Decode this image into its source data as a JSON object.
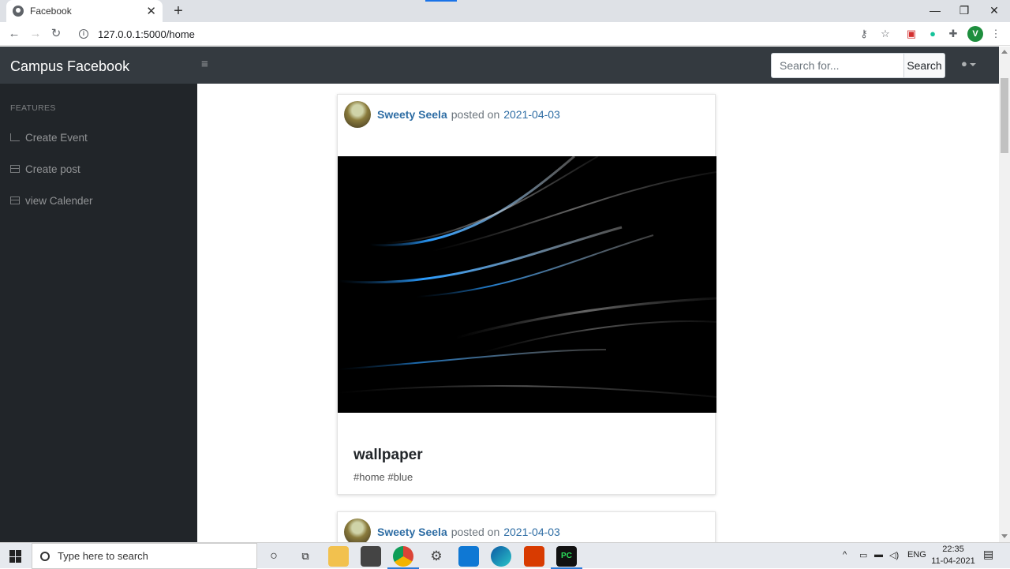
{
  "browser": {
    "tab_title": "Facebook",
    "url": "127.0.0.1:5000/home",
    "profile_initial": "V"
  },
  "navbar": {
    "brand": "Campus Facebook",
    "search_placeholder": "Search for...",
    "search_button": "Search"
  },
  "sidebar": {
    "heading": "FEATURES",
    "items": [
      {
        "label": "Create Event",
        "icon": "chart-area-icon"
      },
      {
        "label": "Create post",
        "icon": "table-icon"
      },
      {
        "label": "view Calender",
        "icon": "table-icon"
      }
    ]
  },
  "posts": [
    {
      "author": "Sweety Seela",
      "posted_on": "posted on",
      "date": "2021-04-03",
      "title": "wallpaper",
      "tags": "#home #blue"
    },
    {
      "author": "Sweety Seela",
      "posted_on": "posted on",
      "date": "2021-04-03"
    }
  ],
  "taskbar": {
    "search_placeholder": "Type here to search",
    "language": "ENG",
    "time": "22:35",
    "date": "11-04-2021"
  }
}
